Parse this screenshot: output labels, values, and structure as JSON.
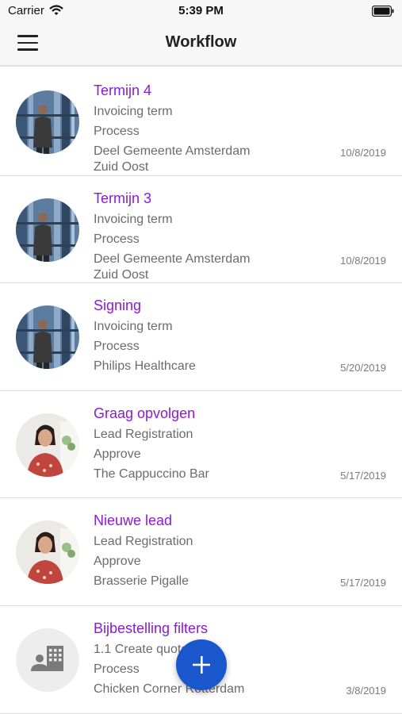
{
  "status_bar": {
    "carrier": "Carrier",
    "time": "5:39 PM"
  },
  "nav": {
    "title": "Workflow",
    "menu_icon": "hamburger-icon"
  },
  "items": [
    {
      "title": "Termijn 4",
      "line1": "Invoicing term",
      "line2": "Process",
      "line3": "Deel Gemeente Amsterdam",
      "line4": "Zuid Oost",
      "date": "10/8/2019",
      "avatar": "man"
    },
    {
      "title": "Termijn 3",
      "line1": "Invoicing term",
      "line2": "Process",
      "line3": "Deel Gemeente Amsterdam",
      "line4": "Zuid Oost",
      "date": "10/8/2019",
      "avatar": "man"
    },
    {
      "title": "Signing",
      "line1": "Invoicing term",
      "line2": "Process",
      "line3": "Philips Healthcare",
      "line4": "",
      "date": "5/20/2019",
      "avatar": "man"
    },
    {
      "title": "Graag opvolgen",
      "line1": "Lead Registration",
      "line2": "Approve",
      "line3": "The Cappuccino Bar",
      "line4": "",
      "date": "5/17/2019",
      "avatar": "woman"
    },
    {
      "title": "Nieuwe lead",
      "line1": "Lead Registration",
      "line2": "Approve",
      "line3": "Brasserie Pigalle",
      "line4": "",
      "date": "5/17/2019",
      "avatar": "woman"
    },
    {
      "title": "Bijbestelling filters",
      "line1": "1.1 Create quote",
      "line2": "Process",
      "line3": "Chicken Corner Rotterdam",
      "line4": "",
      "date": "3/8/2019",
      "avatar": "company"
    }
  ],
  "fab": {
    "icon": "plus-icon"
  },
  "colors": {
    "accent": "#8a1ad6",
    "fab": "#1a57cc",
    "secondary_text": "#6b6b6b"
  }
}
